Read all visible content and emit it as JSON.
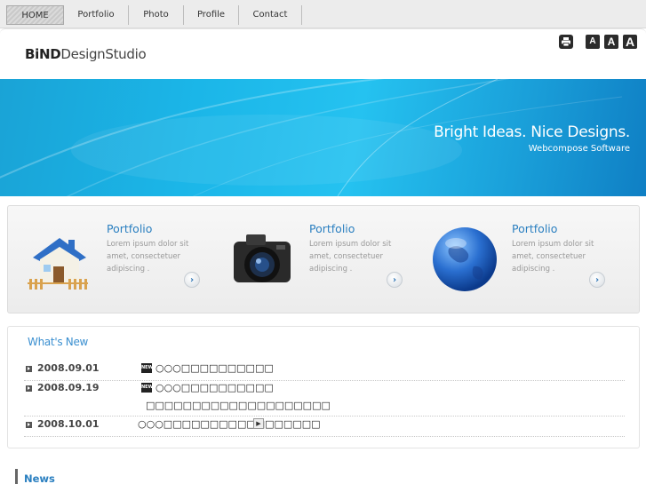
{
  "nav": {
    "items": [
      {
        "label": "HOME",
        "active": true
      },
      {
        "label": "Portfolio",
        "active": false
      },
      {
        "label": "Photo",
        "active": false
      },
      {
        "label": "Profile",
        "active": false
      },
      {
        "label": "Contact",
        "active": false
      }
    ]
  },
  "header": {
    "logo_bold": "BiND",
    "logo_rest": "DesignStudio",
    "font_size_buttons": [
      "A",
      "A",
      "A"
    ],
    "print_icon": "printer-icon"
  },
  "banner": {
    "title": "Bright Ideas. Nice Designs.",
    "subtitle": "Webcompose Software"
  },
  "features": [
    {
      "title": "Portfolio",
      "text": "Lorem ipsum dolor sit amet, consectetuer adipiscing .",
      "icon": "house-icon"
    },
    {
      "title": "Portfolio",
      "text": "Lorem ipsum dolor sit amet, consectetuer adipiscing .",
      "icon": "camera-icon"
    },
    {
      "title": "Portfolio",
      "text": "Lorem ipsum dolor sit amet, consectetuer adipiscing .",
      "icon": "globe-icon"
    }
  ],
  "whats_new": {
    "title": "What's New",
    "items": [
      {
        "date": "2008.09.01",
        "new_badge": "NEW",
        "line1": "○○○□□□□□□□□□□",
        "line2": ""
      },
      {
        "date": "2008.09.19",
        "new_badge": "NEW",
        "line1": "○○○□□□□□□□□□□",
        "line2": "□□□□□□□□□□□□□□□□□□□□"
      },
      {
        "date": "2008.10.01",
        "new_badge": "",
        "line1": "○○○□□□□□□□□□□□□□□□□□",
        "line2": ""
      }
    ]
  },
  "news": {
    "title": "News"
  },
  "colors": {
    "accent_blue": "#2a7fc0",
    "banner_blue": "#1bb6e8"
  }
}
